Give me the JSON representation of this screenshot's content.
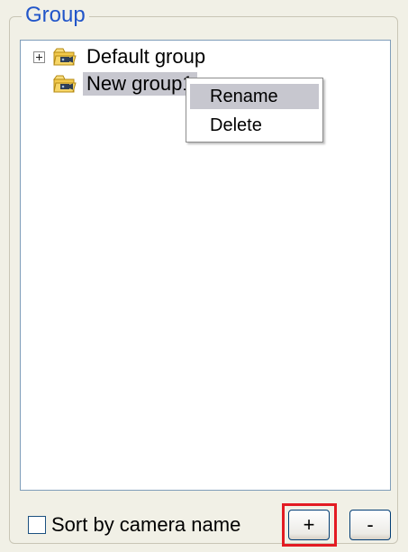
{
  "group_panel": {
    "title": "Group"
  },
  "tree": {
    "items": [
      {
        "label": "Default group",
        "expandable": true,
        "selected": false,
        "icon": "folder-camera-icon"
      },
      {
        "label": "New group1",
        "expandable": false,
        "selected": true,
        "icon": "folder-camera-icon"
      }
    ]
  },
  "context_menu": {
    "items": [
      {
        "label": "Rename",
        "highlighted": true
      },
      {
        "label": "Delete",
        "highlighted": false
      }
    ]
  },
  "bottom": {
    "sort_label": "Sort by camera name",
    "sort_checked": false,
    "add_label": "+",
    "remove_label": "-"
  },
  "colors": {
    "group_title": "#2155c9",
    "selection": "#c7c7cf",
    "annotation": "#e31b23"
  }
}
